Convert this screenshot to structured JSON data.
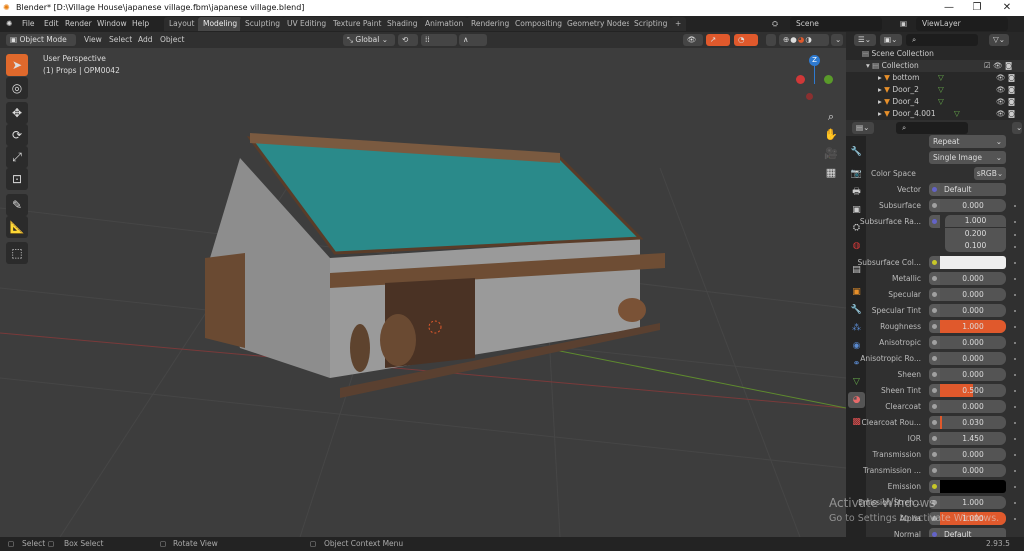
{
  "window": {
    "title": "Blender* [D:\\Village House\\japanese village.fbm\\japanese village.blend]",
    "minimize": "—",
    "restore": "❐",
    "close": "✕"
  },
  "menu": [
    "File",
    "Edit",
    "Render",
    "Window",
    "Help"
  ],
  "workspaces": [
    {
      "label": "Layout"
    },
    {
      "label": "Modeling",
      "active": true
    },
    {
      "label": "Sculpting"
    },
    {
      "label": "UV Editing"
    },
    {
      "label": "Texture Paint"
    },
    {
      "label": "Shading"
    },
    {
      "label": "Animation"
    },
    {
      "label": "Rendering"
    },
    {
      "label": "Compositing"
    },
    {
      "label": "Geometry Nodes"
    },
    {
      "label": "Scripting"
    }
  ],
  "add_workspace": "+",
  "scene": "Scene",
  "view_layer": "ViewLayer",
  "header": {
    "mode": "Object Mode",
    "view": "View",
    "select": "Select",
    "add": "Add",
    "object": "Object",
    "orientation": "Global"
  },
  "viewport": {
    "perspective": "User Perspective",
    "object_info": "(1) Props | OPM0042",
    "gizmo_axis": "Z"
  },
  "outliner": {
    "search_placeholder": "",
    "items": [
      {
        "label": "Scene Collection"
      },
      {
        "label": "Collection"
      },
      {
        "label": "bottom"
      },
      {
        "label": "Door_2"
      },
      {
        "label": "Door_4"
      },
      {
        "label": "Door_4.001"
      }
    ]
  },
  "properties": {
    "dropdowns": {
      "extension": "Repeat",
      "projection": "Single Image",
      "color_space_label": "Color Space",
      "color_space": "sRGB"
    },
    "vector": {
      "label": "Vector",
      "value": "Default"
    },
    "subsurface": {
      "label": "Subsurface",
      "value": "0.000"
    },
    "subsurface_radius": {
      "label": "Subsurface Ra...",
      "values": [
        "1.000",
        "0.200",
        "0.100"
      ]
    },
    "subsurface_color": {
      "label": "Subsurface Col...",
      "color": "#eeeeee"
    },
    "rows": [
      {
        "label": "Metallic",
        "value": "0.000",
        "fill": 0
      },
      {
        "label": "Specular",
        "value": "0.000",
        "fill": 0
      },
      {
        "label": "Specular Tint",
        "value": "0.000",
        "fill": 0
      },
      {
        "label": "Roughness",
        "value": "1.000",
        "fill": 1
      },
      {
        "label": "Anisotropic",
        "value": "0.000",
        "fill": 0
      },
      {
        "label": "Anisotropic Ro...",
        "value": "0.000",
        "fill": 0
      },
      {
        "label": "Sheen",
        "value": "0.000",
        "fill": 0
      },
      {
        "label": "Sheen Tint",
        "value": "0.500",
        "fill": 0.5
      },
      {
        "label": "Clearcoat",
        "value": "0.000",
        "fill": 0
      },
      {
        "label": "Clearcoat Rou...",
        "value": "0.030",
        "fill": 0.03
      },
      {
        "label": "IOR",
        "value": "1.450",
        "fill": 0
      },
      {
        "label": "Transmission",
        "value": "0.000",
        "fill": 0
      },
      {
        "label": "Transmission ...",
        "value": "0.000",
        "fill": 0
      }
    ],
    "emission": {
      "label": "Emission",
      "color": "#000000"
    },
    "emission_strength": {
      "label": "Emission Stren...",
      "value": "1.000"
    },
    "alpha": {
      "label": "Alpha",
      "value": "1.000",
      "fill": 1
    },
    "normal": {
      "label": "Normal",
      "value": "Default"
    }
  },
  "status": {
    "select": "Select",
    "box_select": "Box Select",
    "rotate": "Rotate View",
    "context": "Object Context Menu",
    "version": "2.93.5"
  },
  "watermark": {
    "line1": "Activate Windows",
    "line2": "Go to Settings to activate Windows."
  },
  "colors": {
    "accent": "#e0692c",
    "slider": "#e0592c",
    "roof": "#2a8a8a"
  }
}
